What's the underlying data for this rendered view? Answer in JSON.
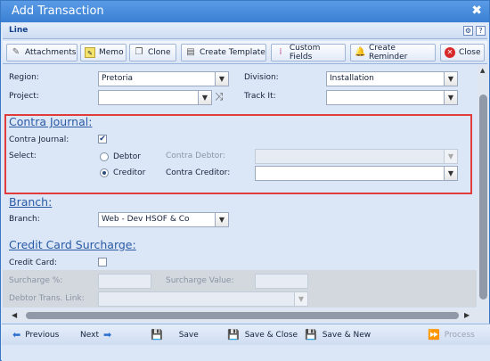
{
  "window": {
    "title": "Add Transaction",
    "close_glyph": "✖"
  },
  "linebar": {
    "label": "Line",
    "icon1": "⚙",
    "icon2": "?"
  },
  "toolbar": {
    "attachments": "Attachments",
    "memo": "Memo",
    "clone": "Clone",
    "create_template": "Create Template",
    "custom_fields": "Custom Fields",
    "create_reminder": "Create Reminder",
    "close": "Close"
  },
  "form": {
    "region_label": "Region:",
    "region_value": "Pretoria",
    "division_label": "Division:",
    "division_value": "Installation",
    "project_label": "Project:",
    "project_value": "",
    "trackit_label": "Track It:",
    "trackit_value": ""
  },
  "contra": {
    "heading": "Contra Journal",
    "colon": ":",
    "journal_label": "Contra Journal:",
    "journal_checked": true,
    "select_label": "Select:",
    "debtor_label": "Debtor",
    "creditor_label": "Creditor",
    "selected": "Creditor",
    "contra_debtor_label": "Contra Debtor:",
    "contra_debtor_value": "",
    "contra_creditor_label": "Contra Creditor:",
    "contra_creditor_value": ""
  },
  "branch": {
    "heading": "Branch",
    "colon": ":",
    "label": "Branch:",
    "value": "Web - Dev HSOF & Co"
  },
  "credit": {
    "heading": "Credit Card Surcharge",
    "colon": ":",
    "card_label": "Credit Card:",
    "card_checked": false,
    "surcharge_pct_label": "Surcharge %:",
    "surcharge_value_label": "Surcharge Value:",
    "debtor_link_label": "Debtor Trans. Link:"
  },
  "bottom": {
    "previous": "Previous",
    "next": "Next",
    "save": "Save",
    "save_close": "Save & Close",
    "save_new": "Save & New",
    "process": "Process"
  },
  "colors": {
    "title_bar": "#3a7fd3",
    "highlight": "#e23b3b",
    "section": "#2a5aa5"
  }
}
